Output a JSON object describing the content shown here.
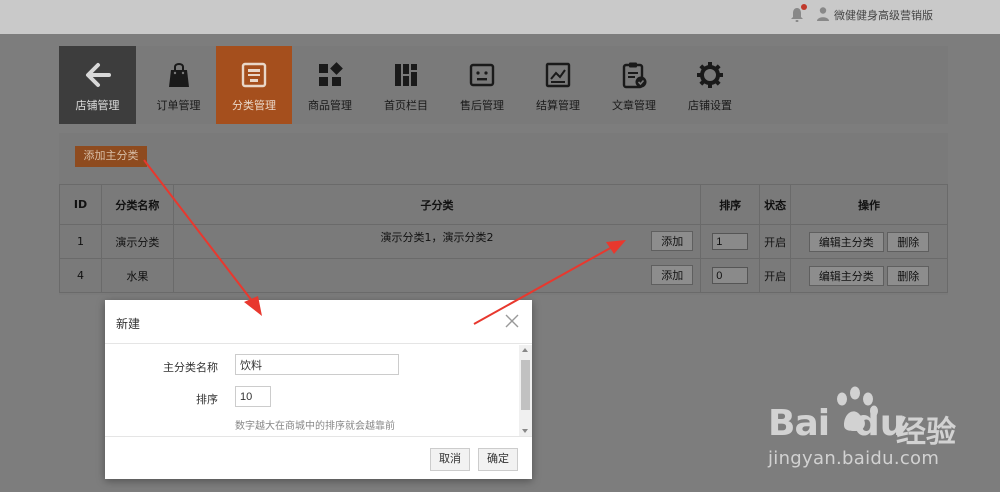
{
  "header": {
    "user_name": "微健健身高级营销版",
    "bell_icon": "bell-icon",
    "user_icon": "user-icon"
  },
  "nav": {
    "items": [
      {
        "label": "店铺管理",
        "icon": "arrow-left-icon",
        "state": "back"
      },
      {
        "label": "订单管理",
        "icon": "shopping-bag-icon",
        "state": "normal"
      },
      {
        "label": "分类管理",
        "icon": "category-icon",
        "state": "active"
      },
      {
        "label": "商品管理",
        "icon": "grid-icon",
        "state": "normal"
      },
      {
        "label": "首页栏目",
        "icon": "columns-icon",
        "state": "normal"
      },
      {
        "label": "售后管理",
        "icon": "service-icon",
        "state": "normal"
      },
      {
        "label": "结算管理",
        "icon": "chart-icon",
        "state": "normal"
      },
      {
        "label": "文章管理",
        "icon": "clipboard-check-icon",
        "state": "normal"
      },
      {
        "label": "店铺设置",
        "icon": "gear-icon",
        "state": "normal"
      }
    ]
  },
  "toolbar": {
    "add_main_label": "添加主分类"
  },
  "table": {
    "columns": [
      "ID",
      "分类名称",
      "子分类",
      "排序",
      "状态",
      "操作"
    ],
    "add_sub_label": "添加",
    "edit_label": "编辑主分类",
    "delete_label": "删除",
    "rows": [
      {
        "id": "1",
        "name": "演示分类",
        "subs": "演示分类1，演示分类2",
        "sort": "1",
        "status": "开启"
      },
      {
        "id": "4",
        "name": "水果",
        "subs": "",
        "sort": "0",
        "status": "开启"
      }
    ]
  },
  "dialog": {
    "title": "新建",
    "name_label": "主分类名称",
    "name_value": "饮料",
    "sort_label": "排序",
    "sort_value": "10",
    "sort_hint": "数字越大在商城中的排序就会越靠前",
    "cancel_label": "取消",
    "ok_label": "确定"
  },
  "watermark": {
    "brand_a": "Bai",
    "brand_b": "du",
    "brand_cn": "经验",
    "url": "jingyan.baidu.com"
  },
  "colors": {
    "accent": "#a54f1d",
    "annotation_arrow": "#e8382e"
  }
}
